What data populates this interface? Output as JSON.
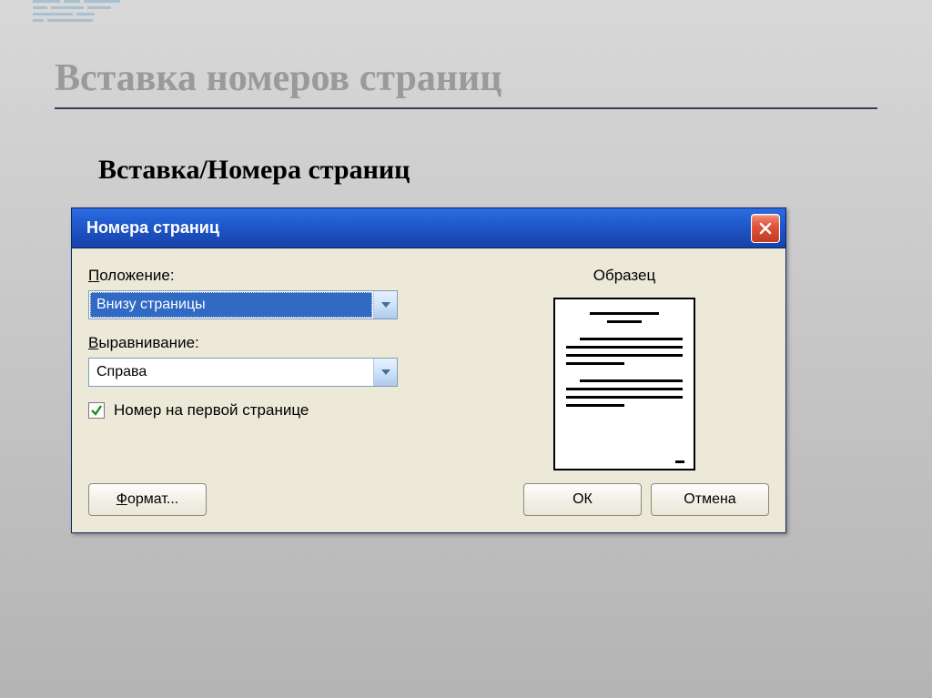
{
  "slide": {
    "title": "Вставка номеров страниц",
    "subtitle": "Вставка/Номера страниц"
  },
  "dialog": {
    "title": "Номера страниц",
    "position_label": "Положение:",
    "position_value": "Внизу страницы",
    "alignment_label": "Выравнивание:",
    "alignment_value": "Справа",
    "checkbox_label": "Номер на первой странице",
    "preview_label": "Образец",
    "format_button": "Формат...",
    "ok_button": "ОК",
    "cancel_button": "Отмена"
  }
}
